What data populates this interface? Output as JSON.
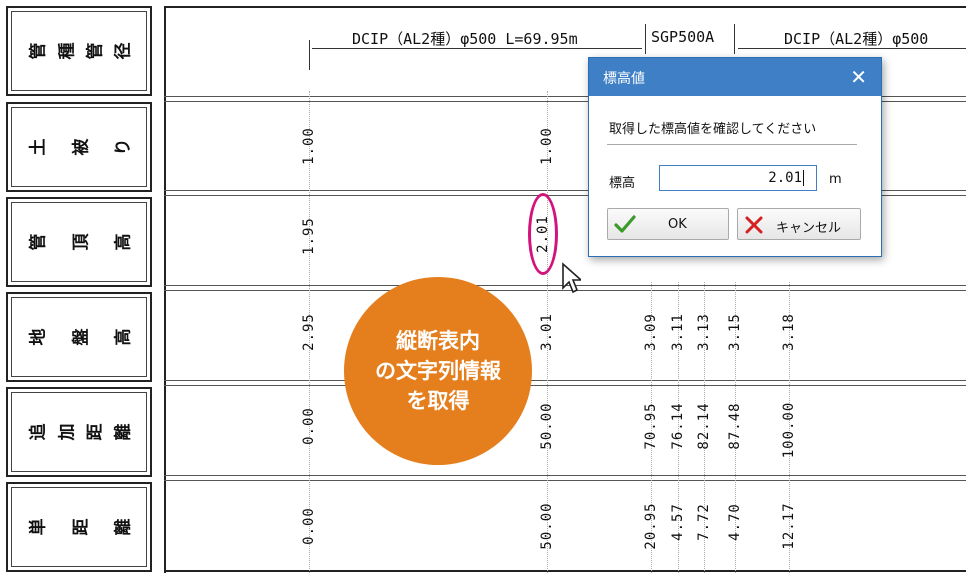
{
  "row_labels": [
    [
      "管",
      "種",
      "管",
      "径"
    ],
    [
      "土",
      "被",
      "り"
    ],
    [
      "管",
      "頂",
      "高"
    ],
    [
      "地",
      "盤",
      "高"
    ],
    [
      "追",
      "加",
      "距",
      "離"
    ],
    [
      "単",
      "距",
      "離"
    ]
  ],
  "header": {
    "seg1": "DCIP（AL2種）φ500 L=69.95m",
    "seg2": "SGP500A",
    "seg3": "DCIP（AL2種）φ500"
  },
  "rows": {
    "cover": [
      "1.00",
      "1.00"
    ],
    "pipe_top": [
      "1.95",
      "2.01"
    ],
    "ground": [
      "2.95",
      "3.01",
      "3.09",
      "3.11",
      "3.13",
      "3.15",
      "3.18"
    ],
    "chainage": [
      "0.00",
      "50.00",
      "70.95",
      "76.14",
      "82.14",
      "87.48",
      "100.00"
    ],
    "single": [
      "0.00",
      "50.00",
      "20.95",
      "4.57",
      "7.72",
      "4.70",
      "12.17"
    ]
  },
  "dialog": {
    "title": "標高値",
    "message": "取得した標高値を確認してください",
    "field_label": "標高",
    "field_value": "2.01",
    "unit": "m",
    "ok_label": "OK",
    "cancel_label": "キャンセル"
  },
  "annotation": {
    "line1": "縦断表内",
    "line2": "の文字列情報",
    "line3": "を取得"
  },
  "colors": {
    "accent": "#3e7fc6",
    "annotation_orange": "#e57f1e",
    "highlight_magenta": "#d4127e"
  }
}
